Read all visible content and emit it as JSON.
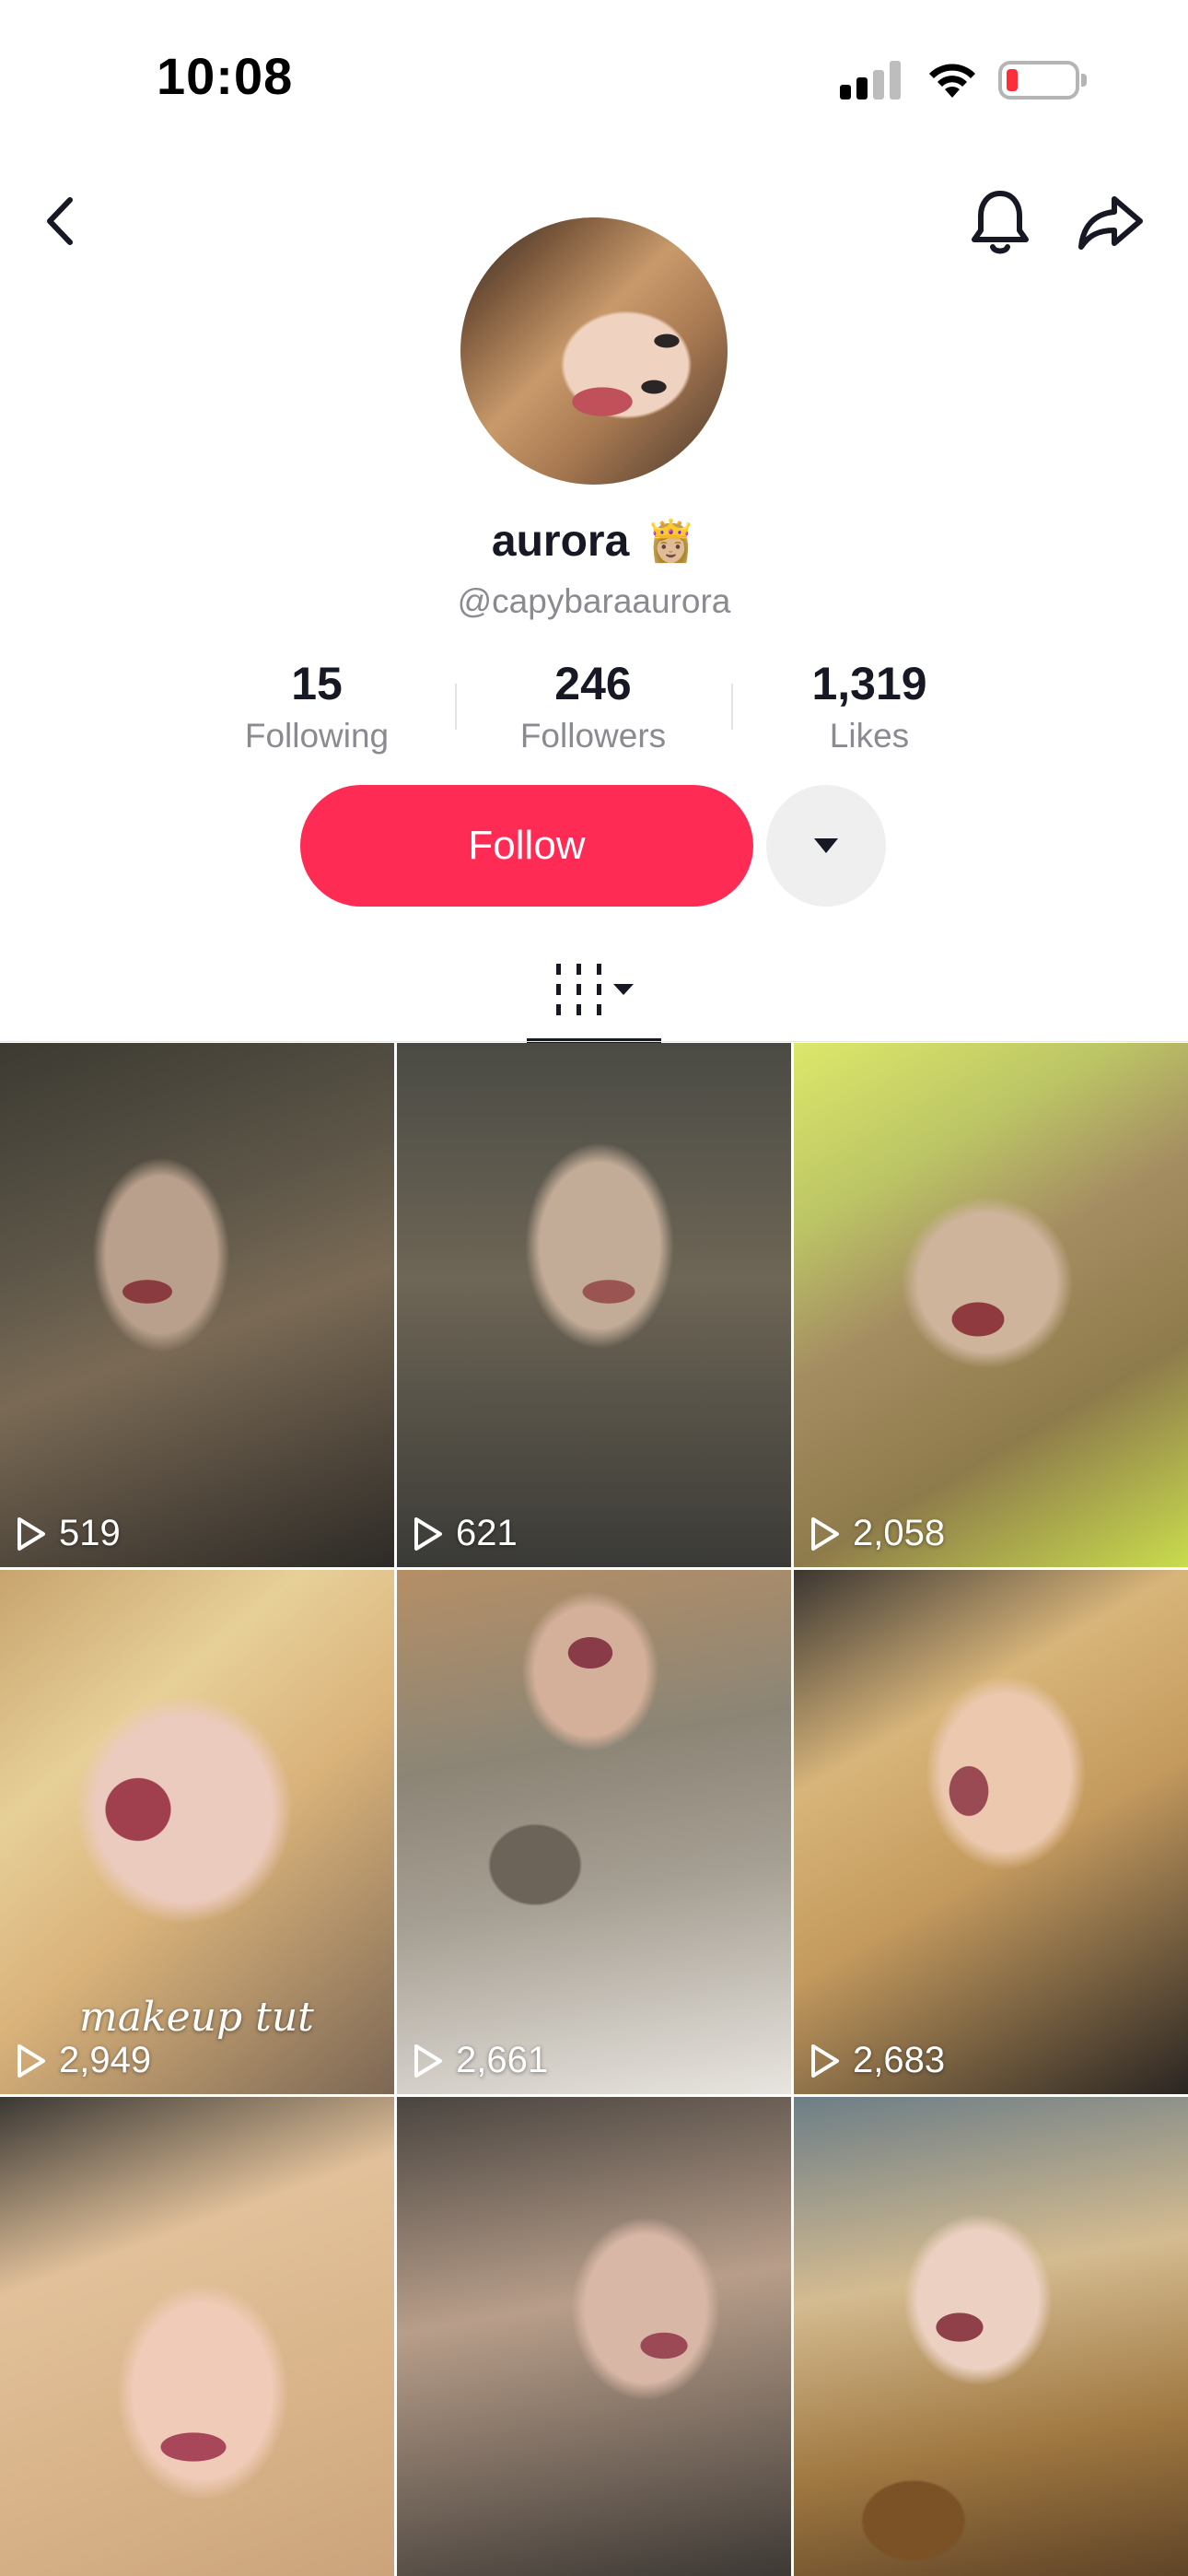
{
  "status_bar": {
    "time": "10:08",
    "icons": [
      "cellular-signal-icon",
      "wifi-icon",
      "battery-low-icon"
    ],
    "battery_color": "#ff2d3a"
  },
  "nav": {
    "icons": [
      "back-chevron-icon",
      "bell-icon",
      "share-arrow-icon"
    ]
  },
  "profile": {
    "display_name": "aurora",
    "name_emoji": "👸🏼",
    "handle": "@capybaraaurora"
  },
  "stats": [
    {
      "value": "15",
      "label": "Following"
    },
    {
      "value": "246",
      "label": "Followers"
    },
    {
      "value": "1,319",
      "label": "Likes"
    }
  ],
  "actions": {
    "follow_label": "Follow",
    "follow_color": "#fe2c55",
    "more_icon": "caret-down-icon"
  },
  "tabs": {
    "active": "videos-grid-icon"
  },
  "videos": [
    {
      "views": "519",
      "caption": ""
    },
    {
      "views": "621",
      "caption": ""
    },
    {
      "views": "2,058",
      "caption": ""
    },
    {
      "views": "2,949",
      "caption": "makeup tut"
    },
    {
      "views": "2,661",
      "caption": ""
    },
    {
      "views": "2,683",
      "caption": ""
    },
    {
      "views": "",
      "caption": ""
    },
    {
      "views": "",
      "caption": ""
    },
    {
      "views": "",
      "caption": ""
    }
  ]
}
